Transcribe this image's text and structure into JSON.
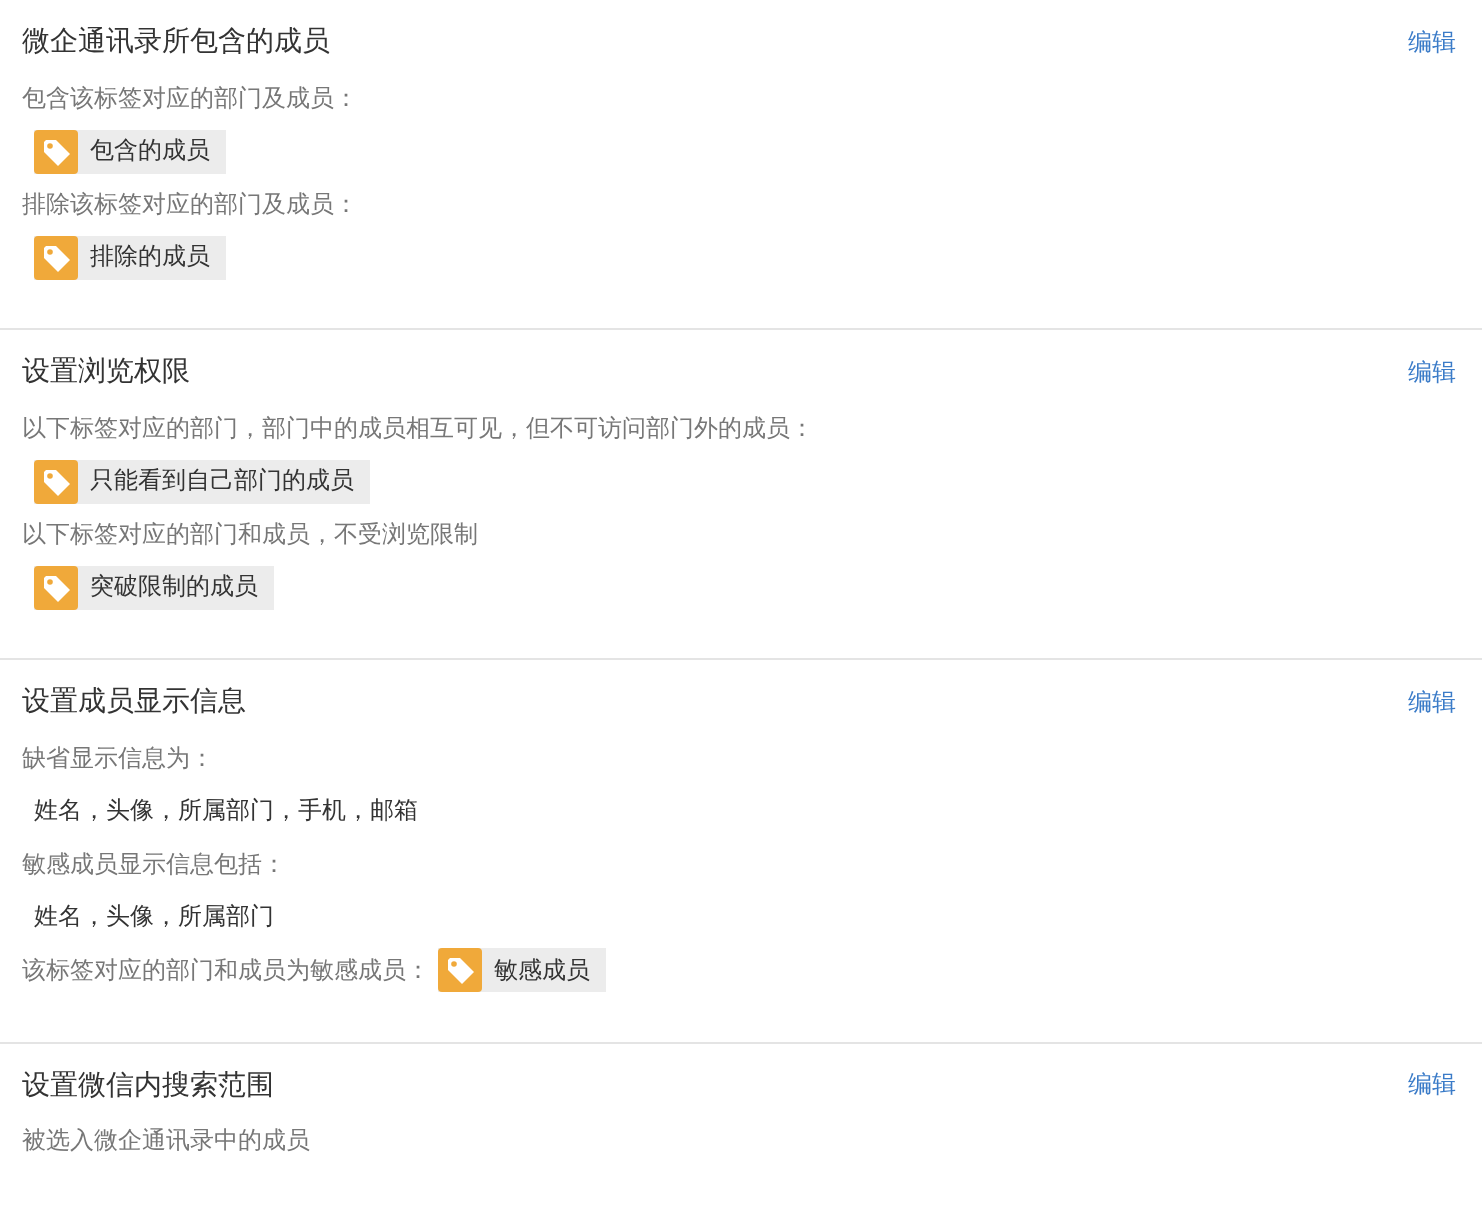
{
  "sections": [
    {
      "title": "微企通讯录所包含的成员",
      "edit": "编辑",
      "lines": [
        {
          "kind": "label",
          "text": "包含该标签对应的部门及成员："
        },
        {
          "kind": "tag",
          "tag": "包含的成员"
        },
        {
          "kind": "label",
          "text": "排除该标签对应的部门及成员："
        },
        {
          "kind": "tag",
          "tag": "排除的成员"
        }
      ]
    },
    {
      "title": "设置浏览权限",
      "edit": "编辑",
      "lines": [
        {
          "kind": "label",
          "text": "以下标签对应的部门，部门中的成员相互可见，但不可访问部门外的成员："
        },
        {
          "kind": "tag",
          "tag": "只能看到自己部门的成员"
        },
        {
          "kind": "label",
          "text": "以下标签对应的部门和成员，不受浏览限制"
        },
        {
          "kind": "tag",
          "tag": "突破限制的成员"
        }
      ]
    },
    {
      "title": "设置成员显示信息",
      "edit": "编辑",
      "lines": [
        {
          "kind": "label",
          "text": "缺省显示信息为："
        },
        {
          "kind": "value",
          "text": "姓名，头像，所属部门，手机，邮箱"
        },
        {
          "kind": "label",
          "text": "敏感成员显示信息包括："
        },
        {
          "kind": "value",
          "text": "姓名，头像，所属部门"
        },
        {
          "kind": "label_tag",
          "text": "该标签对应的部门和成员为敏感成员：",
          "tag": "敏感成员"
        }
      ]
    },
    {
      "title": "设置微信内搜索范围",
      "edit": "编辑",
      "lines": [
        {
          "kind": "label",
          "text": "被选入微企通讯录中的成员"
        }
      ]
    }
  ]
}
